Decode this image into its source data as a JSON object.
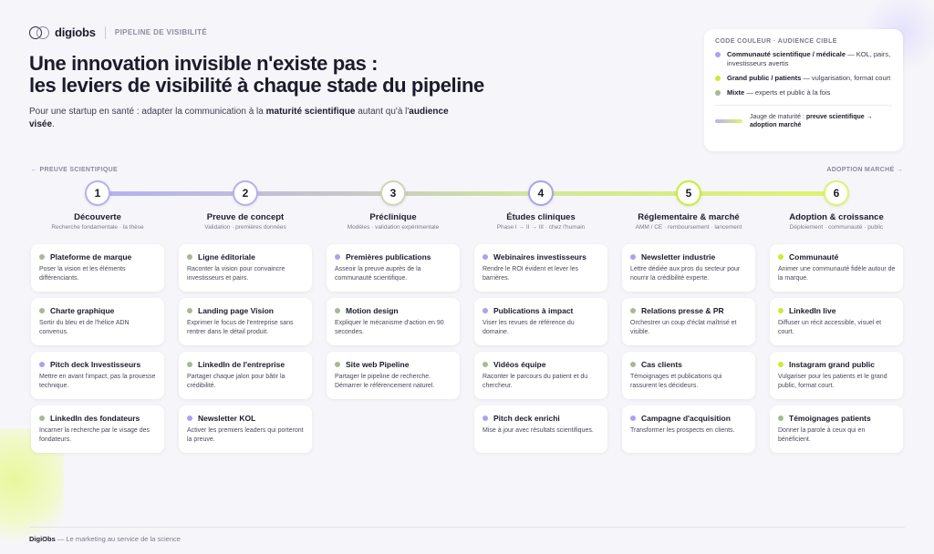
{
  "header": {
    "logo_text": "digiobs",
    "kicker": "PIPELINE DE VISIBILITÉ"
  },
  "title": {
    "line1": "Une innovation invisible n'existe pas :",
    "line2": "les leviers de visibilité à chaque stade du pipeline"
  },
  "subtitle": {
    "part1": "Pour une startup en santé : adapter la communication à la ",
    "bold1": "maturité scientifique",
    "part2": " autant qu'à l'",
    "bold2": "audience visée",
    "part3": "."
  },
  "legend": {
    "title": "CODE COULEUR · AUDIENCE CIBLE",
    "items": [
      {
        "key": "scientific",
        "bold": "Communauté scientifique / médicale",
        "rest": " — KOL, pairs, investisseurs avertis",
        "color": "#a9a2ee"
      },
      {
        "key": "public",
        "bold": "Grand public / patients",
        "rest": " — vulgarisation, format court",
        "color": "#c9ec35"
      },
      {
        "key": "mixed",
        "bold": "Mixte",
        "rest": " — experts et public à la fois",
        "color": "#a9b894"
      }
    ],
    "gauge_label": "Jauge de maturité : ",
    "gauge_bold": "preuve scientifique → adoption marché"
  },
  "axis": {
    "left": "← PREUVE SCIENTIFIQUE",
    "right": "ADOPTION MARCHÉ →"
  },
  "colors": {
    "scientific": "#a9a2ee",
    "public": "#c9ec35",
    "mixed": "#a9b894"
  },
  "stages": [
    {
      "number": "1",
      "name": "Découverte",
      "sub": "Recherche fondamentale · la thèse",
      "ring": "#b6b0f0",
      "cards": [
        {
          "title": "Plateforme de marque",
          "desc": "Poser la vision et les éléments différenciants.",
          "audience": "mixed"
        },
        {
          "title": "Charte graphique",
          "desc": "Sortir du bleu et de l'hélice ADN convenus.",
          "audience": "mixed"
        },
        {
          "title": "Pitch deck Investisseurs",
          "desc": "Mettre en avant l'impact, pas la prouesse technique.",
          "audience": "scientific"
        },
        {
          "title": "LinkedIn des fondateurs",
          "desc": "Incarner la recherche par le visage des fondateurs.",
          "audience": "mixed"
        }
      ]
    },
    {
      "number": "2",
      "name": "Preuve de concept",
      "sub": "Validation · premières données",
      "ring": "#b6b0f0",
      "cards": [
        {
          "title": "Ligne éditoriale",
          "desc": "Raconter la vision pour convaincre investisseurs et pairs.",
          "audience": "mixed"
        },
        {
          "title": "Landing page Vision",
          "desc": "Exprimer le focus de l'entreprise sans rentrer dans le détail produit.",
          "audience": "mixed"
        },
        {
          "title": "LinkedIn de l'entreprise",
          "desc": "Partager chaque jalon pour bâtir la crédibilité.",
          "audience": "mixed"
        },
        {
          "title": "Newsletter KOL",
          "desc": "Activer les premiers leaders qui porteront la preuve.",
          "audience": "scientific"
        }
      ]
    },
    {
      "number": "3",
      "name": "Préclinique",
      "sub": "Modèles · validation expérimentale",
      "ring": "#cfd4b8",
      "cards": [
        {
          "title": "Premières publications",
          "desc": "Asseoir la preuve auprès de la communauté scientifique.",
          "audience": "scientific"
        },
        {
          "title": "Motion design",
          "desc": "Expliquer le mécanisme d'action en 90 secondes.",
          "audience": "mixed"
        },
        {
          "title": "Site web Pipeline",
          "desc": "Partager le pipeline de recherche. Démarrer le référencement naturel.",
          "audience": "mixed"
        }
      ]
    },
    {
      "number": "4",
      "name": "Études cliniques",
      "sub": "Phase I → II → III · chez l'humain",
      "ring": "#a9a2ee",
      "cards": [
        {
          "title": "Webinaires investisseurs",
          "desc": "Rendre le ROI évident et lever les barrières.",
          "audience": "scientific"
        },
        {
          "title": "Publications à impact",
          "desc": "Viser les revues de référence du domaine.",
          "audience": "scientific"
        },
        {
          "title": "Vidéos équipe",
          "desc": "Raconter le parcours du patient et du chercheur.",
          "audience": "mixed"
        },
        {
          "title": "Pitch deck enrichi",
          "desc": "Mise à jour avec résultats scientifiques.",
          "audience": "scientific"
        }
      ]
    },
    {
      "number": "5",
      "name": "Réglementaire & marché",
      "sub": "AMM / CE · remboursement · lancement",
      "ring": "#c9ec35",
      "cards": [
        {
          "title": "Newsletter industrie",
          "desc": "Lettre dédiée aux pros du secteur pour nourrir la crédibilité experte.",
          "audience": "scientific"
        },
        {
          "title": "Relations presse & PR",
          "desc": "Orchestrer un coup d'éclat maîtrisé et visible.",
          "audience": "mixed"
        },
        {
          "title": "Cas clients",
          "desc": "Témoignages et publications qui rassurent les décideurs.",
          "audience": "mixed"
        },
        {
          "title": "Campagne d'acquisition",
          "desc": "Transformer les prospects en clients.",
          "audience": "scientific"
        }
      ]
    },
    {
      "number": "6",
      "name": "Adoption & croissance",
      "sub": "Déploiement · communauté · public",
      "ring": "#dff36d",
      "cards": [
        {
          "title": "Communauté",
          "desc": "Animer une communauté fidèle autour de la marque.",
          "audience": "public"
        },
        {
          "title": "LinkedIn live",
          "desc": "Diffuser un récit accessible, visuel et court.",
          "audience": "public"
        },
        {
          "title": "Instagram grand public",
          "desc": "Vulgariser pour les patients et le grand public, format court.",
          "audience": "public"
        },
        {
          "title": "Témoignages patients",
          "desc": "Donner la parole à ceux qui en bénéficient.",
          "audience": "mixed"
        }
      ]
    }
  ],
  "footer": {
    "brand": "DigiObs",
    "tagline": " — Le marketing au service de la science"
  }
}
